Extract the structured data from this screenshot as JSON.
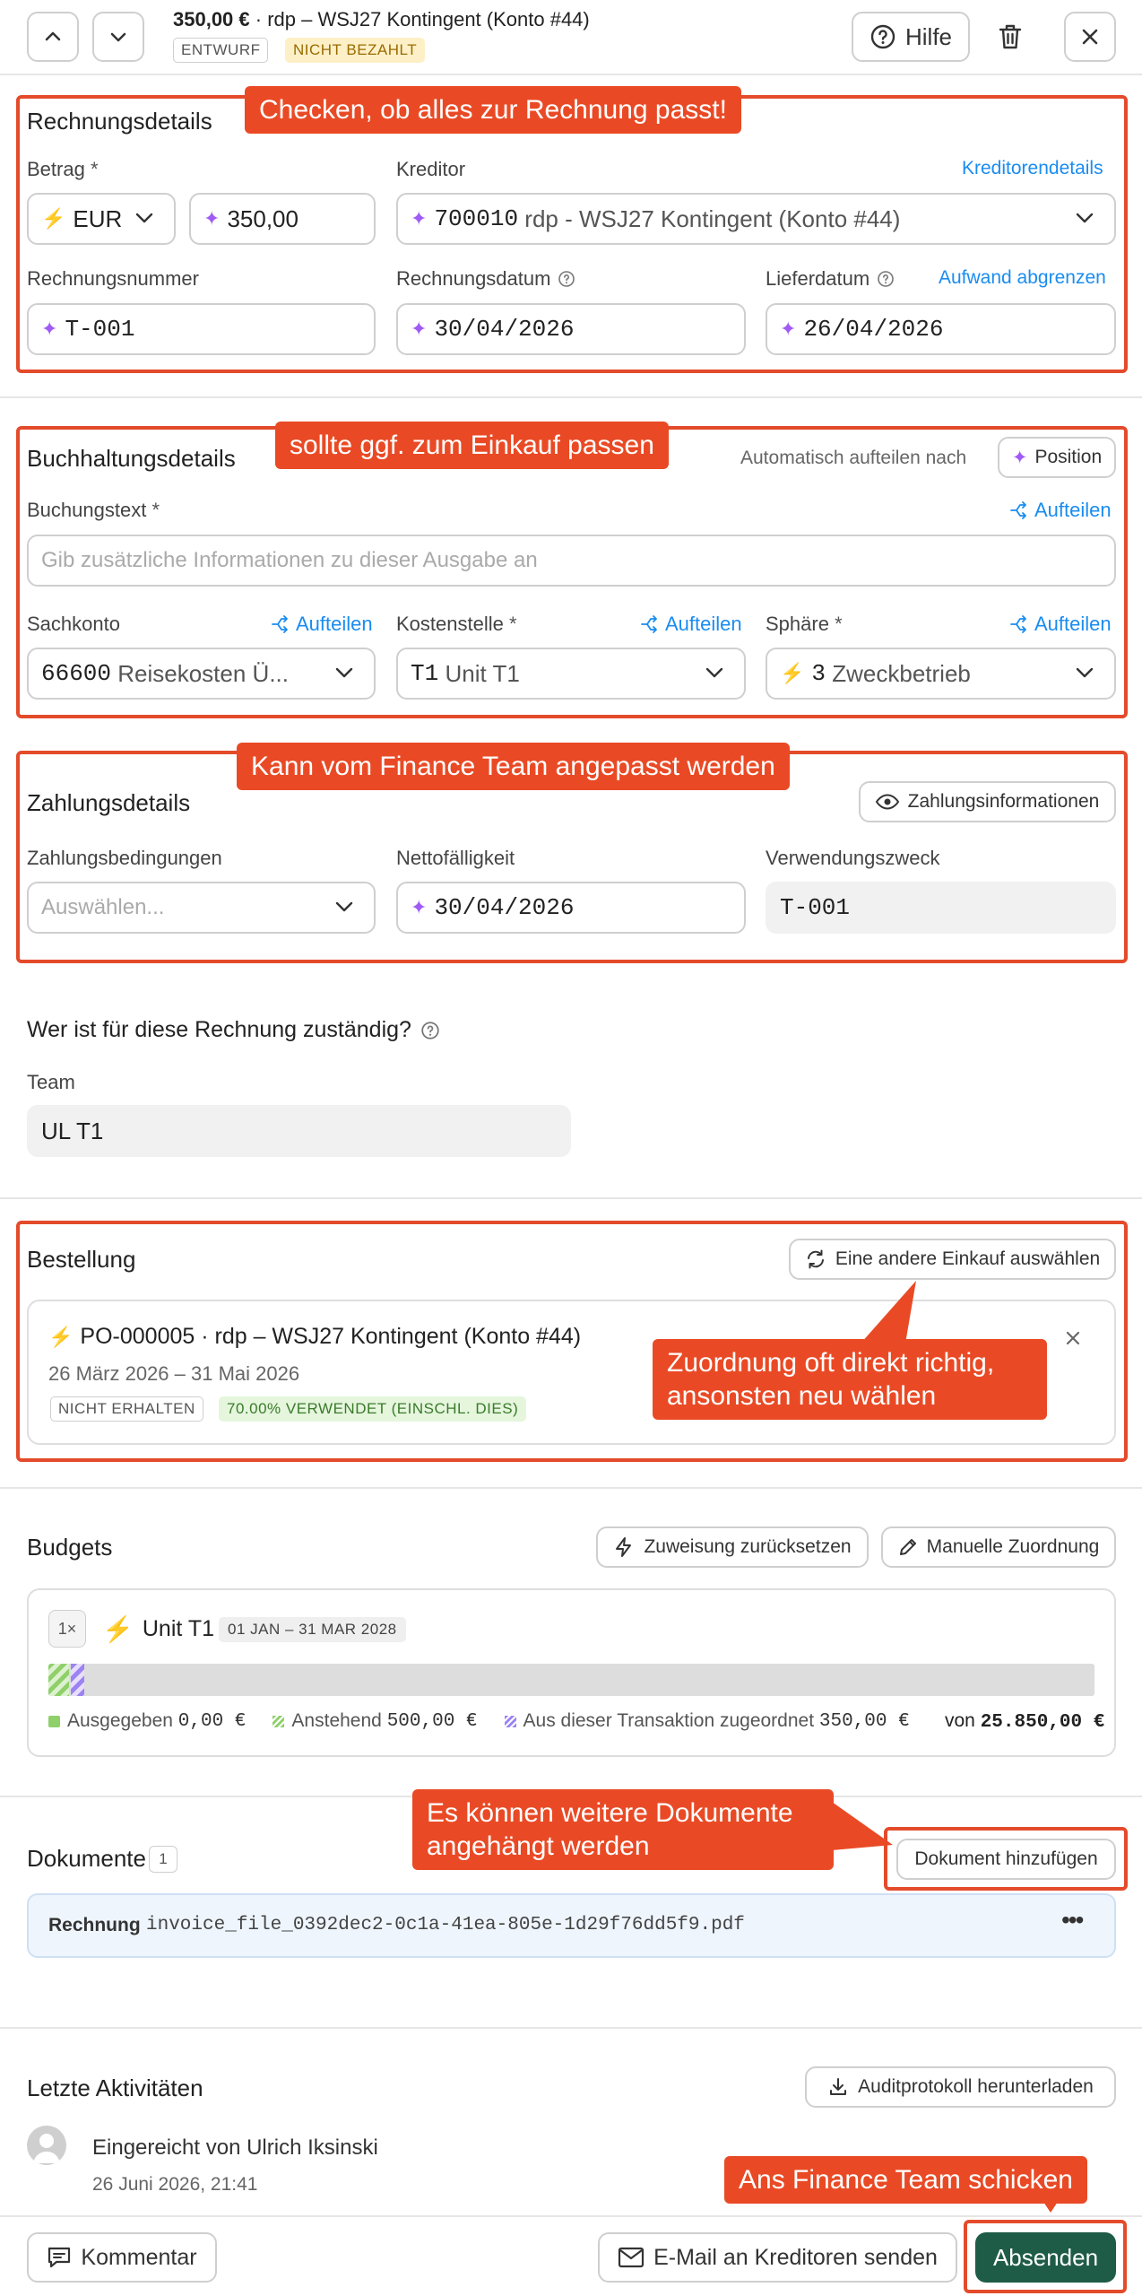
{
  "header": {
    "amount": "350,00 €",
    "title": " · rdp – WSJ27 Kontingent (Konto #44)",
    "status_draft": "ENTWURF",
    "status_payment": "NICHT BEZAHLT",
    "help_label": "Hilfe"
  },
  "callouts": {
    "c1": "Checken, ob alles zur Rechnung passt!",
    "c2": "sollte ggf. zum Einkauf passen",
    "c3": "Kann vom Finance Team angepasst werden",
    "c4": "Zuordnung oft direkt richtig, ansonsten neu wählen",
    "c5": "Es können weitere Dokumente angehängt werden",
    "c6": "Ans Finance Team schicken"
  },
  "invoice": {
    "title": "Rechnungsdetails",
    "amount_label": "Betrag",
    "currency": "EUR",
    "amount_value": "350,00",
    "creditor_label": "Kreditor",
    "creditor_details_link": "Kreditorendetails",
    "creditor_number": "700010",
    "creditor_name": "rdp - WSJ27 Kontingent (Konto #44)",
    "number_label": "Rechnungsnummer",
    "number_value": "T-001",
    "date_label": "Rechnungsdatum",
    "date_value": "30/04/2026",
    "delivery_label": "Lieferdatum",
    "delivery_link": "Aufwand abgrenzen",
    "delivery_value": "26/04/2026"
  },
  "accounting": {
    "title": "Buchhaltungsdetails",
    "auto_split_label": "Automatisch aufteilen nach",
    "position_button": "Position",
    "booking_text_label": "Buchungstext",
    "split_link": "Aufteilen",
    "booking_text_placeholder": "Gib zusätzliche Informationen zu dieser Ausgabe an",
    "ledger_label": "Sachkonto",
    "ledger_number": "66600",
    "ledger_name": "Reisekosten Ü...",
    "cost_center_label": "Kostenstelle",
    "cost_center_code": "T1",
    "cost_center_name": "Unit T1",
    "sphere_label": "Sphäre",
    "sphere_code": "3",
    "sphere_name": "Zweckbetrieb"
  },
  "payment": {
    "title": "Zahlungsdetails",
    "info_button": "Zahlungsinformationen",
    "terms_label": "Zahlungsbedingungen",
    "terms_placeholder": "Auswählen...",
    "net_due_label": "Nettofälligkeit",
    "net_due_value": "30/04/2026",
    "purpose_label": "Verwendungszweck",
    "purpose_value": "T-001"
  },
  "responsible": {
    "question": "Wer ist für diese Rechnung zuständig?",
    "team_label": "Team",
    "team_value": "UL T1"
  },
  "order": {
    "title": "Bestellung",
    "choose_button": "Eine andere Einkauf auswählen",
    "po_id": "PO-000005",
    "po_name": " · rdp – WSJ27 Kontingent (Konto #44)",
    "date_range": "26 März 2026 – 31 Mai 2026",
    "status_received": "NICHT ERHALTEN",
    "status_used": "70.00% VERWENDET (EINSCHL. DIES)"
  },
  "budgets": {
    "title": "Budgets",
    "reset_button": "Zuweisung zurücksetzen",
    "manual_button": "Manuelle Zuordnung",
    "multiplier": "1×",
    "unit_name": "Unit T1",
    "period": "01 JAN – 31 MAR 2028",
    "spent_label": "Ausgegeben",
    "spent_value": "0,00 €",
    "pending_label": "Anstehend",
    "pending_value": "500,00 €",
    "assigned_label": "Aus dieser Transaktion zugeordnet",
    "assigned_value": "350,00 €",
    "of_label": "von",
    "total_value": "25.850,00 €",
    "pending_fraction": 0.0193,
    "assigned_fraction": 0.0135
  },
  "documents": {
    "title": "Dokumente",
    "count": "1",
    "add_button": "Dokument hinzufügen",
    "doc_type": "Rechnung",
    "doc_filename": "invoice_file_0392dec2-0c1a-41ea-805e-1d29f76dd5f9.pdf"
  },
  "activity": {
    "title": "Letzte Aktivitäten",
    "audit_button": "Auditprotokoll herunterladen",
    "entry_text": "Eingereicht von Ulrich Iksinski",
    "entry_time": "26 Juni 2026, 21:41"
  },
  "footer": {
    "comment_button": "Kommentar",
    "email_button": "E-Mail an Kreditoren senden",
    "submit_button": "Absenden"
  },
  "colors": {
    "accent_red": "#e94a25",
    "link_blue": "#1a8cf0",
    "submit_green": "#1f5c48",
    "sparkle_purple": "#a05af5"
  }
}
